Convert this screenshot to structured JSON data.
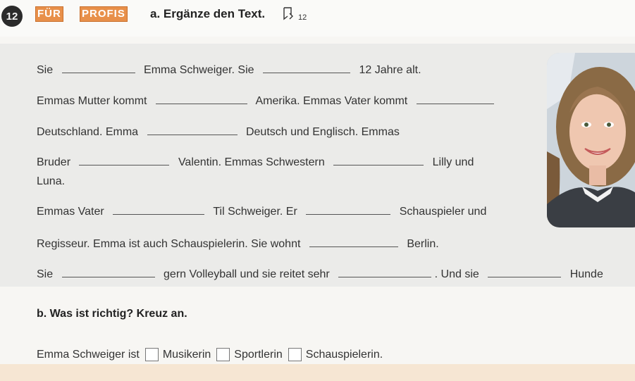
{
  "header": {
    "exercise_number": "12",
    "brand_word1": "FÜR",
    "brand_word2": "PROFIS",
    "task_a_title": "a. Ergänze den Text.",
    "track_number": "12"
  },
  "cloze": {
    "line1": [
      "Sie",
      "Emma Schweiger. Sie",
      "12 Jahre alt."
    ],
    "line2": [
      "Emmas Mutter kommt",
      "Amerika. Emmas Vater kommt"
    ],
    "line3": [
      "Deutschland. Emma",
      "Deutsch und Englisch. Emmas"
    ],
    "line4": [
      "Bruder",
      "Valentin. Emmas Schwestern",
      "Lilly und"
    ],
    "line5": [
      "Luna."
    ],
    "line6": [
      "Emmas Vater",
      "Til Schweiger. Er",
      "Schauspieler und"
    ],
    "line7": [
      "Regisseur. Emma ist auch Schauspielerin. Sie wohnt",
      "Berlin."
    ],
    "line8": [
      "Sie",
      "gern Volleyball und sie reitet sehr",
      ". Und sie",
      "Hunde"
    ]
  },
  "task_b": {
    "title": "b. Was ist richtig? Kreuz an.",
    "prompt": "Emma Schweiger ist",
    "options": [
      "Musikerin",
      "Sportlerin",
      "Schauspielerin."
    ]
  },
  "colors": {
    "brand_orange": "#e8904a",
    "card_gray": "#ebebe9",
    "footer_peach": "#f6e6d3"
  }
}
